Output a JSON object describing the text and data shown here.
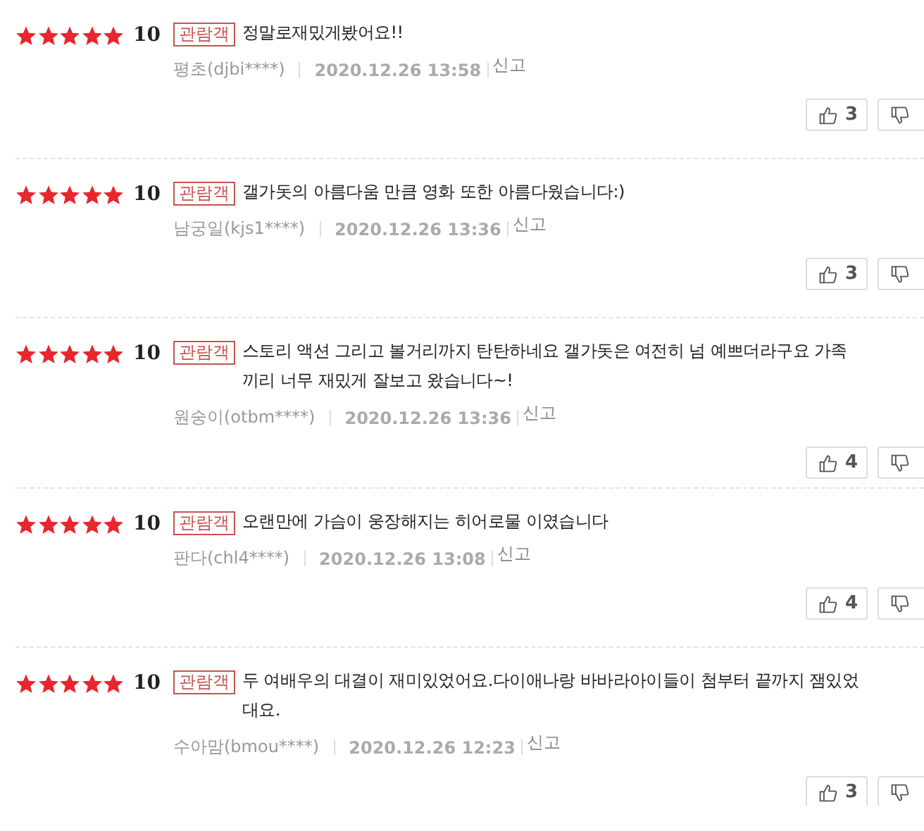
{
  "reviews": [
    {
      "stars": 5,
      "score": "10",
      "badge": "관람객",
      "text": "정말로재밌게봤어요!!",
      "author": "평초(djbi****)",
      "date": "2020.12.26 13:58",
      "report": "신고",
      "likes": "3"
    },
    {
      "stars": 5,
      "score": "10",
      "badge": "관람객",
      "text": "갤가돗의 아름다움 만큼 영화 또한 아름다웠습니다:)",
      "author": "남궁일(kjs1****)",
      "date": "2020.12.26 13:36",
      "report": "신고",
      "likes": "3"
    },
    {
      "stars": 5,
      "score": "10",
      "badge": "관람객",
      "text": "스토리 액션 그리고 볼거리까지 탄탄하네요 갤가돗은 여전히 넘 예쁘더라구요 가족\n끼리 너무 재밌게 잘보고 왔습니다~!",
      "author": "원숭이(otbm****)",
      "date": "2020.12.26 13:36",
      "report": "신고",
      "likes": "4"
    },
    {
      "stars": 5,
      "score": "10",
      "badge": "관람객",
      "text": "오랜만에 가슴이 웅장해지는 히어로물 이였습니다",
      "author": "판다(chl4****)",
      "date": "2020.12.26 13:08",
      "report": "신고",
      "likes": "4"
    },
    {
      "stars": 5,
      "score": "10",
      "badge": "관람객",
      "text": "두 여배우의 대결이 재미있었어요.다이애나랑 바바라아이들이 첨부터 끝까지 잼있었\n대요.",
      "author": "수아맘(bmou****)",
      "date": "2020.12.26 12:23",
      "report": "신고",
      "likes": "3"
    }
  ]
}
